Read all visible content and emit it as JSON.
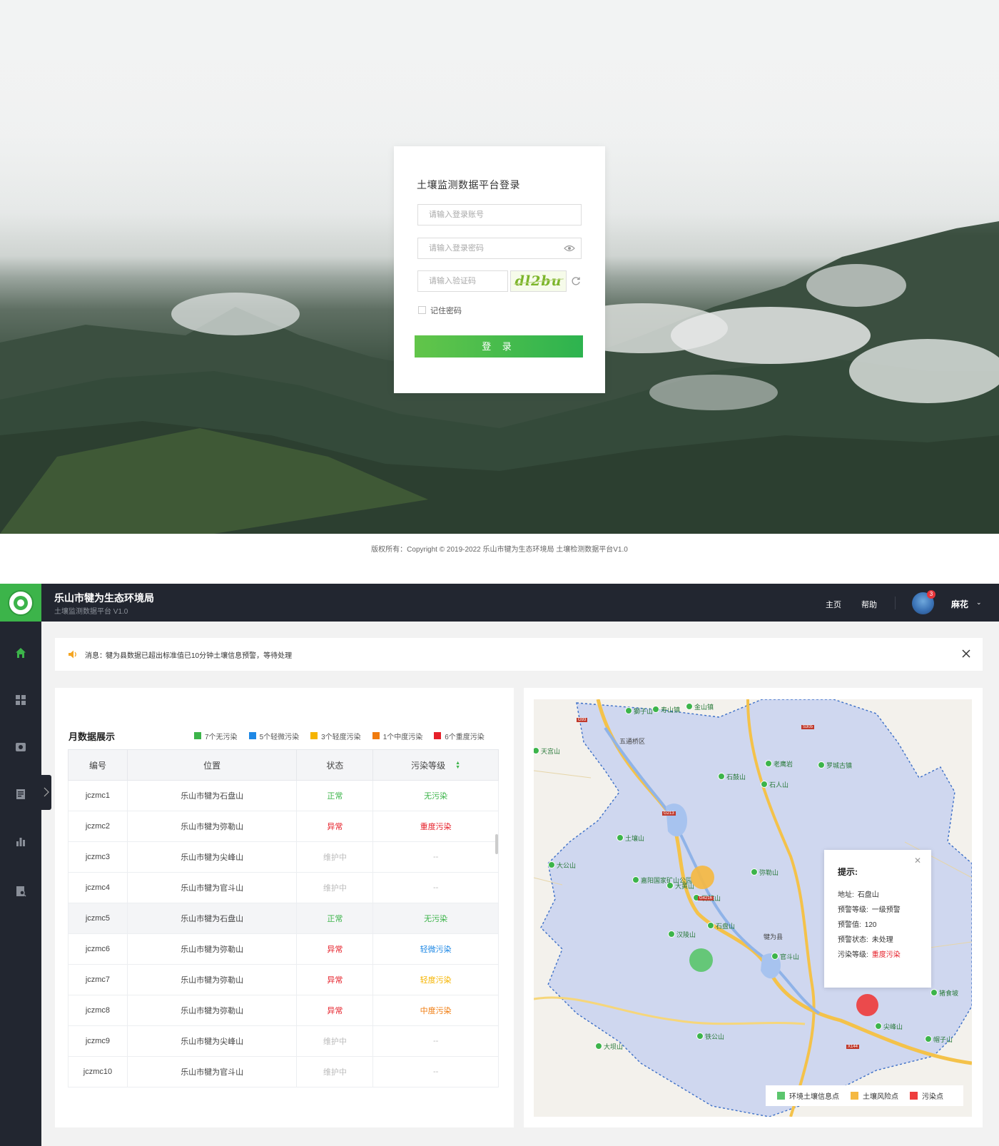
{
  "login": {
    "title": "土壤监测数据平台登录",
    "account_placeholder": "请输入登录账号",
    "password_placeholder": "请输入登录密码",
    "captcha_placeholder": "请输入验证码",
    "captcha_text": "dl2bu",
    "remember_label": "记住密码",
    "submit_label": "登 录",
    "copyright": "版权所有：Copyright © 2019-2022 乐山市犍为生态环境局 土壤检测数据平台V1.0"
  },
  "header": {
    "org_name": "乐山市犍为生态环境局",
    "platform_name": "土壤监测数据平台 V1.0",
    "nav": [
      "主页",
      "帮助"
    ],
    "notification_count": "3",
    "user_name": "麻花",
    "user_menu_icon": "chevron-down-icon"
  },
  "sidebar": {
    "items": [
      {
        "icon": "home-icon",
        "active": true
      },
      {
        "icon": "grid-icon",
        "active": false
      },
      {
        "icon": "camera-icon",
        "active": false
      },
      {
        "icon": "report-icon",
        "active": false
      },
      {
        "icon": "bar-chart-icon",
        "active": false
      },
      {
        "icon": "file-search-icon",
        "active": false
      }
    ]
  },
  "notice": {
    "label": "消息：",
    "text": "犍为县数据已超出标准值已10分钟土壤信息预警，等待处理"
  },
  "monthly": {
    "title": "月数据展示",
    "legend": [
      {
        "label": "7个无污染",
        "color": "#3cb44a"
      },
      {
        "label": "5个轻微污染",
        "color": "#1e88e5"
      },
      {
        "label": "3个轻度污染",
        "color": "#f5b400"
      },
      {
        "label": "1个中度污染",
        "color": "#f07b0e"
      },
      {
        "label": "6个重度污染",
        "color": "#e6202a"
      }
    ],
    "columns": [
      "编号",
      "位置",
      "状态",
      "污染等级"
    ],
    "rows": [
      {
        "id": "jczmc1",
        "location": "乐山市犍为石盘山",
        "status": "正常",
        "status_color": "#3cb44a",
        "level": "无污染",
        "level_color": "#3cb44a"
      },
      {
        "id": "jczmc2",
        "location": "乐山市犍为弥勒山",
        "status": "异常",
        "status_color": "#e6202a",
        "level": "重度污染",
        "level_color": "#e6202a"
      },
      {
        "id": "jczmc3",
        "location": "乐山市犍为尖峰山",
        "status": "维护中",
        "status_color": "#bbbbbb",
        "level": "--",
        "level_color": "#bbbbbb"
      },
      {
        "id": "jczmc4",
        "location": "乐山市犍为官斗山",
        "status": "维护中",
        "status_color": "#bbbbbb",
        "level": "--",
        "level_color": "#bbbbbb"
      },
      {
        "id": "jczmc5",
        "location": "乐山市犍为石盘山",
        "status": "正常",
        "status_color": "#3cb44a",
        "level": "无污染",
        "level_color": "#3cb44a"
      },
      {
        "id": "jczmc6",
        "location": "乐山市犍为弥勒山",
        "status": "异常",
        "status_color": "#e6202a",
        "level": "轻微污染",
        "level_color": "#1e88e5"
      },
      {
        "id": "jczmc7",
        "location": "乐山市犍为弥勒山",
        "status": "异常",
        "status_color": "#e6202a",
        "level": "轻度污染",
        "level_color": "#f5b400"
      },
      {
        "id": "jczmc8",
        "location": "乐山市犍为弥勒山",
        "status": "异常",
        "status_color": "#e6202a",
        "level": "中度污染",
        "level_color": "#f07b0e"
      },
      {
        "id": "jczmc9",
        "location": "乐山市犍为尖峰山",
        "status": "维护中",
        "status_color": "#bbbbbb",
        "level": "--",
        "level_color": "#bbbbbb"
      },
      {
        "id": "jczmc10",
        "location": "乐山市犍为官斗山",
        "status": "维护中",
        "status_color": "#bbbbbb",
        "level": "--",
        "level_color": "#bbbbbb"
      }
    ]
  },
  "map": {
    "place_labels": [
      "五通桥区",
      "犍为县",
      "石盘山",
      "汉陵山",
      "大黄山",
      "尖峰山",
      "官斗山",
      "弥勒山",
      "土壤山",
      "大公山",
      "铁公山",
      "罗城古镇",
      "老鹰岩",
      "獅子山",
      "天宫山",
      "金山镇",
      "寿山镇",
      "嘉阳国家矿山公园",
      "石院山",
      "猪食坡",
      "帽子山",
      "大坝山",
      "石鼓山",
      "石人山"
    ],
    "road_labels": [
      "G93",
      "G213",
      "G4216",
      "X144",
      "S305"
    ],
    "tip": {
      "title": "提示:",
      "rows": [
        {
          "label": "地址:",
          "value": "石盘山",
          "color": "#333333"
        },
        {
          "label": "预警等级:",
          "value": "一级预警",
          "color": "#333333"
        },
        {
          "label": "预警值:",
          "value": "120",
          "color": "#333333"
        },
        {
          "label": "预警状态:",
          "value": "未处理",
          "color": "#333333"
        },
        {
          "label": "污染等级:",
          "value": "重度污染",
          "color": "#e6202a"
        }
      ]
    },
    "legend": [
      {
        "label": "环境土壤信息点",
        "color": "#5cc66e"
      },
      {
        "label": "土壤风险点",
        "color": "#f5b942"
      },
      {
        "label": "污染点",
        "color": "#ee3e3e"
      }
    ],
    "markers": [
      {
        "name": "risk-marker",
        "color": "#f5b942"
      },
      {
        "name": "info-marker",
        "color": "#5cc66e"
      },
      {
        "name": "pollution-marker",
        "color": "#ee3e3e"
      }
    ]
  }
}
